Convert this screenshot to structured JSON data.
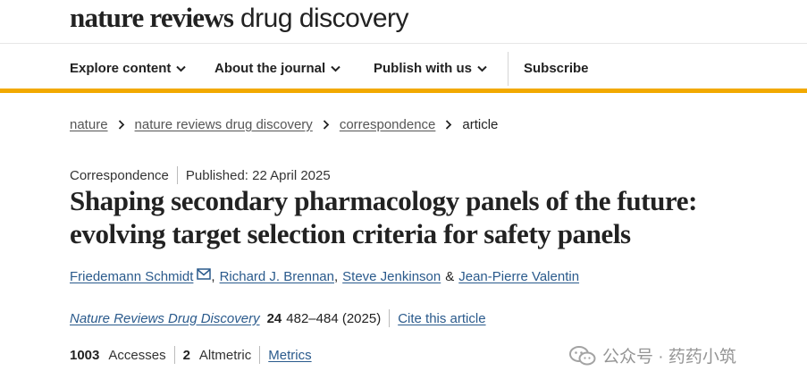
{
  "header": {
    "logo_brand": "nature reviews",
    "logo_sub": "drug discovery"
  },
  "nav": {
    "items": [
      {
        "label": "Explore content"
      },
      {
        "label": "About the journal"
      },
      {
        "label": "Publish with us"
      }
    ],
    "subscribe_label": "Subscribe",
    "accent_color": "#f2a900"
  },
  "breadcrumb": {
    "items": [
      "nature",
      "nature reviews drug discovery",
      "correspondence"
    ],
    "current": "article"
  },
  "article": {
    "type": "Correspondence",
    "published": "Published: 22 April 2025",
    "title": "Shaping secondary pharmacology panels of the future: evolving target selection criteria for safety panels",
    "authors": [
      {
        "name": "Friedemann Schmidt",
        "email_icon": "mail-icon"
      },
      {
        "name": "Richard J. Brennan"
      },
      {
        "name": "Steve Jenkinson"
      },
      {
        "name": "Jean-Pierre Valentin"
      }
    ],
    "author_separators": [
      ",",
      ",",
      "&"
    ],
    "journal": "Nature Reviews Drug Discovery",
    "volume": "24",
    "pages_year": "482–484 (2025)",
    "cite_label": "Cite this article",
    "metrics": {
      "accesses_count": "1003",
      "accesses_label": "Accesses",
      "altmetric_count": "2",
      "altmetric_label": "Altmetric",
      "metrics_link": "Metrics"
    }
  },
  "watermark": {
    "text": "公众号 · 药药小筑"
  }
}
